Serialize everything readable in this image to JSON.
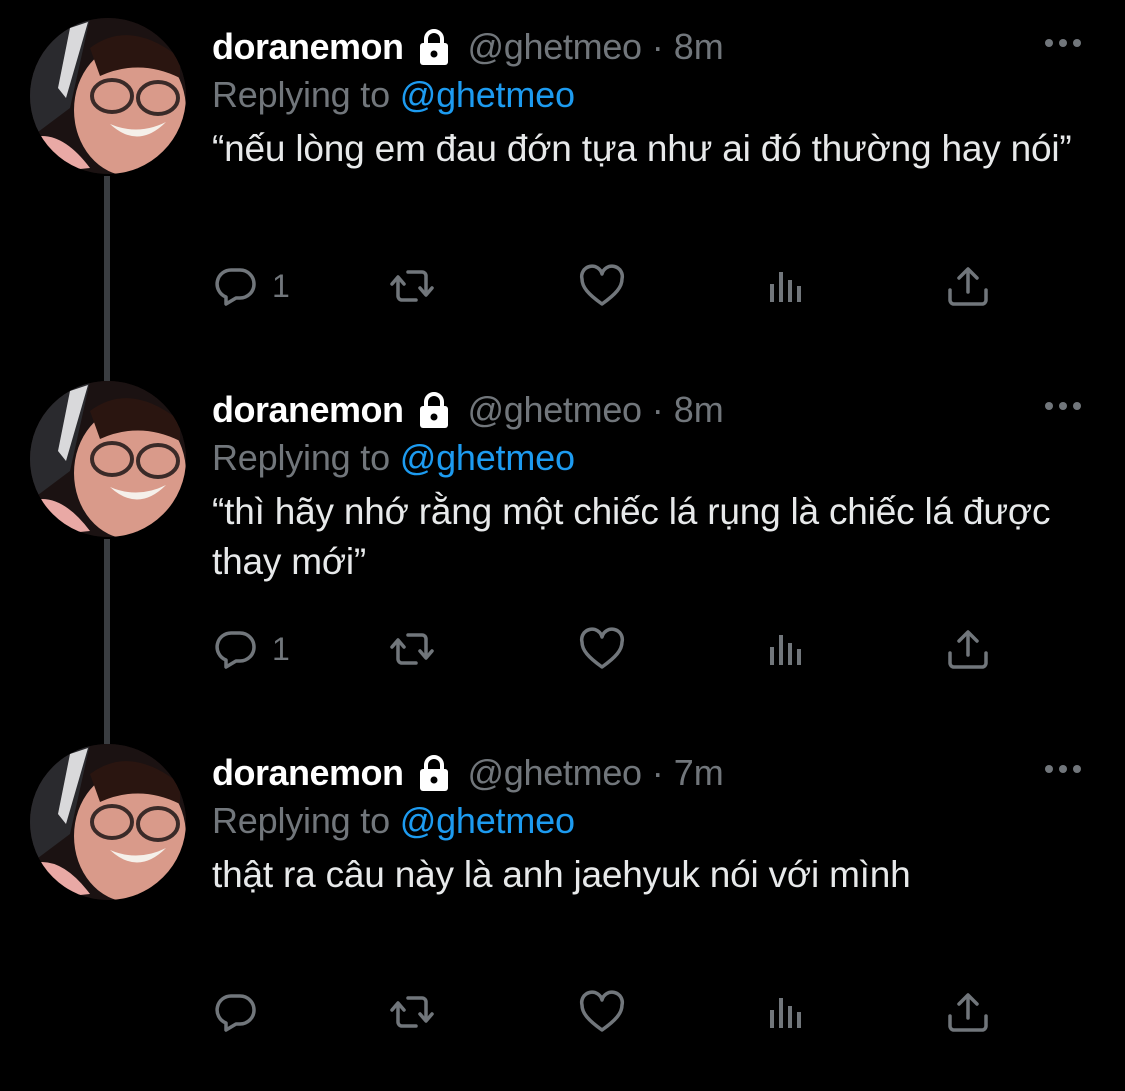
{
  "colors": {
    "background": "#000000",
    "name": "#ffffff",
    "muted": "#71767b",
    "mention": "#1d9bf0",
    "text": "#e7e9ea"
  },
  "icons": {
    "lock": "lock-icon",
    "more": "more-horizontal-icon",
    "reply": "reply-icon",
    "retweet": "retweet-icon",
    "like": "heart-icon",
    "analytics": "analytics-icon",
    "share": "share-icon"
  },
  "tweets": [
    {
      "display_name": "doranemon",
      "handle": "@ghetmeo",
      "separator": "·",
      "time": "8m",
      "replying_prefix": "Replying to",
      "replying_to": "@ghetmeo",
      "text": "“nếu lòng em đau đớn tựa như ai đó thường hay nói”",
      "reply_count": "1"
    },
    {
      "display_name": "doranemon",
      "handle": "@ghetmeo",
      "separator": "·",
      "time": "8m",
      "replying_prefix": "Replying to",
      "replying_to": "@ghetmeo",
      "text": "“thì hãy nhớ rằng một chiếc lá rụng là chiếc lá được thay mới”",
      "reply_count": "1"
    },
    {
      "display_name": "doranemon",
      "handle": "@ghetmeo",
      "separator": "·",
      "time": "7m",
      "replying_prefix": "Replying to",
      "replying_to": "@ghetmeo",
      "text": "thật ra câu này là anh jaehyuk nói với mình",
      "reply_count": ""
    }
  ]
}
